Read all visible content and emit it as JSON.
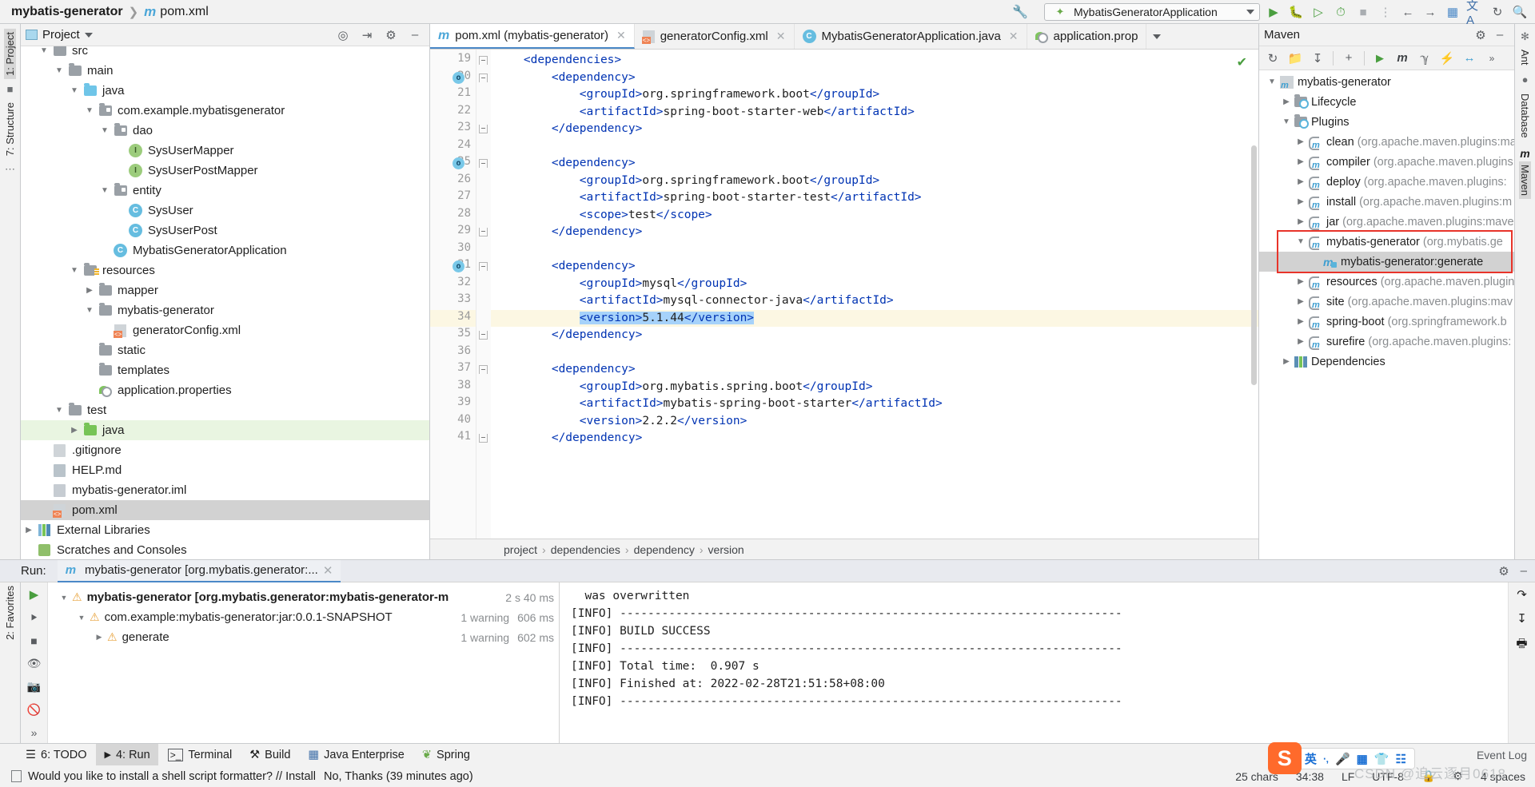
{
  "titlebar": {
    "project_name": "mybatis-generator",
    "file_name": "pom.xml",
    "run_config": "MybatisGeneratorApplication"
  },
  "project_panel": {
    "title": "Project",
    "left_strip": [
      "1: Project",
      "7: Structure"
    ],
    "tree": [
      {
        "indent": 1,
        "arrow": "down",
        "icon": "folder-gray",
        "label": "src",
        "state": "clipped"
      },
      {
        "indent": 2,
        "arrow": "down",
        "icon": "folder-gray",
        "label": "main"
      },
      {
        "indent": 3,
        "arrow": "down",
        "icon": "folder-blue",
        "label": "java"
      },
      {
        "indent": 4,
        "arrow": "down",
        "icon": "folder-package",
        "label": "com.example.mybatisgenerator"
      },
      {
        "indent": 5,
        "arrow": "down",
        "icon": "folder-package",
        "label": "dao"
      },
      {
        "indent": 6,
        "arrow": "none",
        "icon": "interface",
        "label": "SysUserMapper"
      },
      {
        "indent": 6,
        "arrow": "none",
        "icon": "interface",
        "label": "SysUserPostMapper"
      },
      {
        "indent": 5,
        "arrow": "down",
        "icon": "folder-package",
        "label": "entity"
      },
      {
        "indent": 6,
        "arrow": "none",
        "icon": "class",
        "label": "SysUser"
      },
      {
        "indent": 6,
        "arrow": "none",
        "icon": "class",
        "label": "SysUserPost"
      },
      {
        "indent": 5,
        "arrow": "none",
        "icon": "class-run",
        "label": "MybatisGeneratorApplication"
      },
      {
        "indent": 3,
        "arrow": "down",
        "icon": "folder-res",
        "label": "resources"
      },
      {
        "indent": 4,
        "arrow": "right",
        "icon": "folder-gray",
        "label": "mapper"
      },
      {
        "indent": 4,
        "arrow": "down",
        "icon": "folder-gray",
        "label": "mybatis-generator"
      },
      {
        "indent": 5,
        "arrow": "none",
        "icon": "xml",
        "label": "generatorConfig.xml"
      },
      {
        "indent": 4,
        "arrow": "none",
        "icon": "folder-gray",
        "label": "static"
      },
      {
        "indent": 4,
        "arrow": "none",
        "icon": "folder-gray",
        "label": "templates"
      },
      {
        "indent": 4,
        "arrow": "none",
        "icon": "spring",
        "label": "application.properties"
      },
      {
        "indent": 2,
        "arrow": "down",
        "icon": "folder-gray",
        "label": "test"
      },
      {
        "indent": 3,
        "arrow": "right",
        "icon": "folder-green",
        "label": "java",
        "row_state": "selected-green"
      },
      {
        "indent": 1,
        "arrow": "none",
        "icon": "file-gitignore",
        "label": ".gitignore"
      },
      {
        "indent": 1,
        "arrow": "none",
        "icon": "file-md",
        "label": "HELP.md"
      },
      {
        "indent": 1,
        "arrow": "none",
        "icon": "file-iml",
        "label": "mybatis-generator.iml"
      },
      {
        "indent": 1,
        "arrow": "none",
        "icon": "file-maven",
        "label": "pom.xml",
        "row_state": "selected-gray"
      },
      {
        "indent": 0,
        "arrow": "right",
        "icon": "libraries",
        "label": "External Libraries"
      },
      {
        "indent": 0,
        "arrow": "none",
        "icon": "scratches",
        "label": "Scratches and Consoles"
      }
    ]
  },
  "editor": {
    "tabs": [
      {
        "label": "pom.xml (mybatis-generator)",
        "icon": "maven-m-icon",
        "active": true,
        "closable": true
      },
      {
        "label": "generatorConfig.xml",
        "icon": "xml-icon",
        "active": false,
        "closable": true
      },
      {
        "label": "MybatisGeneratorApplication.java",
        "icon": "java-run-icon",
        "active": false,
        "closable": true
      },
      {
        "label": "application.prop",
        "icon": "spring-icon",
        "active": false,
        "closable": false
      }
    ],
    "first_line_number": 19,
    "lines": [
      {
        "n": 19,
        "indent": 1,
        "text": "<dependencies>",
        "fold": "down",
        "marker": false
      },
      {
        "n": 20,
        "indent": 2,
        "text": "<dependency>",
        "fold": "down",
        "marker": true
      },
      {
        "n": 21,
        "indent": 3,
        "text": "<groupId>org.springframework.boot</groupId>",
        "fold": "none",
        "marker": false
      },
      {
        "n": 22,
        "indent": 3,
        "text": "<artifactId>spring-boot-starter-web</artifactId>",
        "fold": "none",
        "marker": false
      },
      {
        "n": 23,
        "indent": 2,
        "text": "</dependency>",
        "fold": "up",
        "marker": false
      },
      {
        "n": 24,
        "indent": 0,
        "text": "",
        "fold": "none",
        "marker": false
      },
      {
        "n": 25,
        "indent": 2,
        "text": "<dependency>",
        "fold": "down",
        "marker": true
      },
      {
        "n": 26,
        "indent": 3,
        "text": "<groupId>org.springframework.boot</groupId>",
        "fold": "none",
        "marker": false
      },
      {
        "n": 27,
        "indent": 3,
        "text": "<artifactId>spring-boot-starter-test</artifactId>",
        "fold": "none",
        "marker": false
      },
      {
        "n": 28,
        "indent": 3,
        "text": "<scope>test</scope>",
        "fold": "none",
        "marker": false
      },
      {
        "n": 29,
        "indent": 2,
        "text": "</dependency>",
        "fold": "up",
        "marker": false
      },
      {
        "n": 30,
        "indent": 0,
        "text": "",
        "fold": "none",
        "marker": false
      },
      {
        "n": 31,
        "indent": 2,
        "text": "<dependency>",
        "fold": "down",
        "marker": true
      },
      {
        "n": 32,
        "indent": 3,
        "text": "<groupId>mysql</groupId>",
        "fold": "none",
        "marker": false
      },
      {
        "n": 33,
        "indent": 3,
        "text": "<artifactId>mysql-connector-java</artifactId>",
        "fold": "none",
        "marker": false
      },
      {
        "n": 34,
        "indent": 3,
        "text": "<version>5.1.44</version>",
        "fold": "none",
        "marker": false,
        "highlight": true,
        "selected": true
      },
      {
        "n": 35,
        "indent": 2,
        "text": "</dependency>",
        "fold": "up",
        "marker": false
      },
      {
        "n": 36,
        "indent": 0,
        "text": "",
        "fold": "none",
        "marker": false
      },
      {
        "n": 37,
        "indent": 2,
        "text": "<dependency>",
        "fold": "down",
        "marker": false
      },
      {
        "n": 38,
        "indent": 3,
        "text": "<groupId>org.mybatis.spring.boot</groupId>",
        "fold": "none",
        "marker": false
      },
      {
        "n": 39,
        "indent": 3,
        "text": "<artifactId>mybatis-spring-boot-starter</artifactId>",
        "fold": "none",
        "marker": false
      },
      {
        "n": 40,
        "indent": 3,
        "text": "<version>2.2.2</version>",
        "fold": "none",
        "marker": false
      },
      {
        "n": 41,
        "indent": 2,
        "text": "</dependency>",
        "fold": "up",
        "marker": false
      }
    ],
    "breadcrumbs": [
      "project",
      "dependencies",
      "dependency",
      "version"
    ]
  },
  "maven_panel": {
    "title": "Maven",
    "toolbar_icons": [
      "reload-icon",
      "add-folder-icon",
      "download-sources-icon",
      "plus-icon",
      "run-icon",
      "maven-m-icon",
      "skip-tests-icon",
      "offline-mode-icon",
      "expand-icon",
      "more-icon"
    ],
    "tree": [
      {
        "indent": 0,
        "arrow": "down",
        "icon": "maven-project-icon",
        "label": "mybatis-generator",
        "sub": ""
      },
      {
        "indent": 1,
        "arrow": "right",
        "icon": "lifecycle-icon",
        "label": "Lifecycle",
        "sub": ""
      },
      {
        "indent": 1,
        "arrow": "down",
        "icon": "plugins-icon",
        "label": "Plugins",
        "sub": ""
      },
      {
        "indent": 2,
        "arrow": "right",
        "icon": "plugin-icon",
        "label": "clean",
        "sub": "(org.apache.maven.plugins:ma"
      },
      {
        "indent": 2,
        "arrow": "right",
        "icon": "plugin-icon",
        "label": "compiler",
        "sub": "(org.apache.maven.plugins:"
      },
      {
        "indent": 2,
        "arrow": "right",
        "icon": "plugin-icon",
        "label": "deploy",
        "sub": "(org.apache.maven.plugins:"
      },
      {
        "indent": 2,
        "arrow": "right",
        "icon": "plugin-icon",
        "label": "install",
        "sub": "(org.apache.maven.plugins:m"
      },
      {
        "indent": 2,
        "arrow": "right",
        "icon": "plugin-icon",
        "label": "jar",
        "sub": "(org.apache.maven.plugins:mave"
      },
      {
        "indent": 2,
        "arrow": "down",
        "icon": "plugin-icon",
        "label": "mybatis-generator",
        "sub": "(org.mybatis.ge",
        "highlight_box": true
      },
      {
        "indent": 3,
        "arrow": "none",
        "icon": "goal-icon",
        "label": "mybatis-generator:generate",
        "sub": "",
        "row_state": "selected-gray",
        "highlight_box": true
      },
      {
        "indent": 2,
        "arrow": "right",
        "icon": "plugin-icon",
        "label": "resources",
        "sub": "(org.apache.maven.plugin"
      },
      {
        "indent": 2,
        "arrow": "right",
        "icon": "plugin-icon",
        "label": "site",
        "sub": "(org.apache.maven.plugins:mav"
      },
      {
        "indent": 2,
        "arrow": "right",
        "icon": "plugin-icon",
        "label": "spring-boot",
        "sub": "(org.springframework.b"
      },
      {
        "indent": 2,
        "arrow": "right",
        "icon": "plugin-icon",
        "label": "surefire",
        "sub": "(org.apache.maven.plugins:"
      },
      {
        "indent": 1,
        "arrow": "right",
        "icon": "dependencies-icon",
        "label": "Dependencies",
        "sub": ""
      }
    ],
    "right_strip": [
      "Ant",
      "Database",
      "Maven"
    ]
  },
  "run_panel": {
    "run_label": "Run:",
    "tab_label": "mybatis-generator [org.mybatis.generator:...",
    "left_strip": "2: Favorites",
    "tree": [
      {
        "indent": 0,
        "arrow": "down",
        "label": "mybatis-generator [org.mybatis.generator:mybatis-generator-m",
        "warnings": "",
        "time": "2 s 40 ms",
        "bold": true
      },
      {
        "indent": 1,
        "arrow": "down",
        "label": "com.example:mybatis-generator:jar:0.0.1-SNAPSHOT",
        "warnings": "1 warning",
        "time": "606 ms",
        "bold": false
      },
      {
        "indent": 2,
        "arrow": "right",
        "label": "generate",
        "warnings": "1 warning",
        "time": "602 ms",
        "bold": false
      }
    ],
    "console": [
      "  was overwritten",
      "[INFO] ------------------------------------------------------------------------",
      "[INFO] BUILD SUCCESS",
      "[INFO] ------------------------------------------------------------------------",
      "[INFO] Total time:  0.907 s",
      "[INFO] Finished at: 2022-02-28T21:51:58+08:00",
      "[INFO] ------------------------------------------------------------------------"
    ]
  },
  "toolwindow_bar": {
    "items": [
      {
        "label": "6: TODO",
        "icon": "todo-icon",
        "active": false
      },
      {
        "label": "4: Run",
        "icon": "run-icon",
        "active": true
      },
      {
        "label": "Terminal",
        "icon": "terminal-icon",
        "active": false
      },
      {
        "label": "Build",
        "icon": "build-hammer-icon",
        "active": false
      },
      {
        "label": "Java Enterprise",
        "icon": "java-enterprise-icon",
        "active": false
      },
      {
        "label": "Spring",
        "icon": "spring-leaf-icon",
        "active": false
      }
    ],
    "right_label": "Event Log"
  },
  "statusbar": {
    "message": "Would you like to install a shell script formatter? // Install",
    "action": "No, Thanks (39 minutes ago)",
    "chars": "25 chars",
    "caret": "34:38",
    "line_sep": "LF",
    "encoding": "UTF-8",
    "indent": "4 spaces",
    "watermark": "CSDN @追云逐月0618",
    "ime": {
      "logo": "S",
      "lang": "英",
      "icons": [
        "dot-icon",
        "mic-icon",
        "keyboard-icon",
        "skin-icon",
        "tools-icon"
      ]
    }
  }
}
